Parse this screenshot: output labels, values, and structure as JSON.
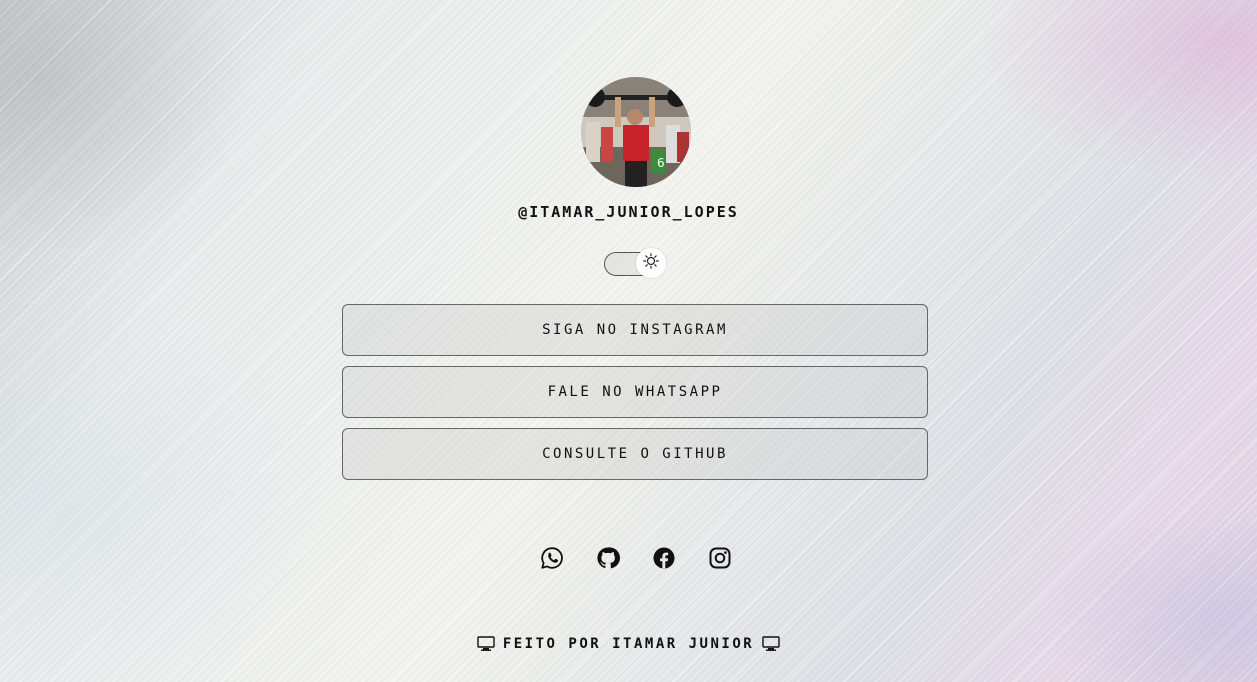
{
  "profile": {
    "username": "@ITAMAR_JUNIOR_LOPES"
  },
  "theme_toggle": {
    "icon": "sun-icon",
    "state": "light"
  },
  "links": [
    {
      "label": "SIGA NO INSTAGRAM"
    },
    {
      "label": "FALE NO WHATSAPP"
    },
    {
      "label": "CONSULTE O GITHUB"
    }
  ],
  "socials": [
    {
      "icon": "whatsapp-icon"
    },
    {
      "icon": "github-icon"
    },
    {
      "icon": "facebook-icon"
    },
    {
      "icon": "instagram-icon"
    }
  ],
  "footer": {
    "text": "FEITO POR ITAMAR JUNIOR",
    "icon": "computer-icon"
  }
}
